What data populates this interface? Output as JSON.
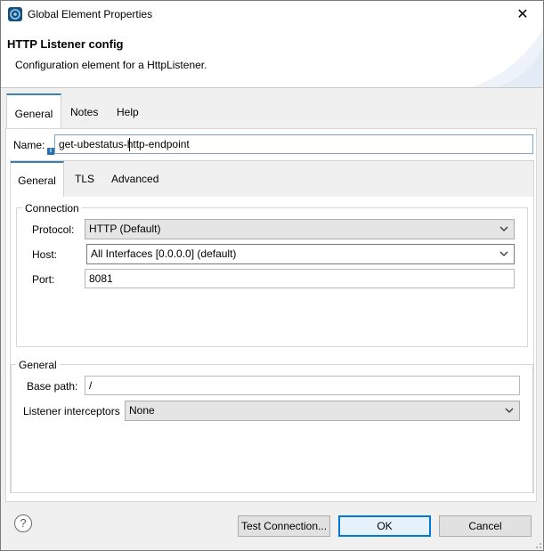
{
  "window": {
    "title": "Global Element Properties",
    "close_glyph": "✕"
  },
  "header": {
    "title": "HTTP Listener config",
    "description": "Configuration element for a HttpListener."
  },
  "outer_tabs": [
    {
      "label": "General",
      "active": true
    },
    {
      "label": "Notes"
    },
    {
      "label": "Help"
    }
  ],
  "name_field": {
    "label": "Name:",
    "value": "get-ubestatus-http-endpoint"
  },
  "inner_tabs": [
    {
      "label": "General",
      "active": true
    },
    {
      "label": "TLS"
    },
    {
      "label": "Advanced"
    }
  ],
  "connection": {
    "title": "Connection",
    "protocol": {
      "label": "Protocol:",
      "value": "HTTP (Default)"
    },
    "host": {
      "label": "Host:",
      "value": "All Interfaces [0.0.0.0] (default)"
    },
    "port": {
      "label": "Port:",
      "value": "8081"
    }
  },
  "general": {
    "title": "General",
    "base_path": {
      "label": "Base path:",
      "value": "/"
    },
    "interceptors": {
      "label": "Listener interceptors",
      "value": "None"
    }
  },
  "footer": {
    "help_glyph": "?",
    "test_connection": "Test Connection...",
    "ok": "OK",
    "cancel": "Cancel"
  },
  "colors": {
    "active_tab_accent": "#3c7fb1",
    "default_button_border": "#0078d7"
  },
  "icons": [
    "app-icon",
    "close-icon",
    "info-icon",
    "chevron-down-icon",
    "help-icon",
    "resize-grip-icon"
  ]
}
